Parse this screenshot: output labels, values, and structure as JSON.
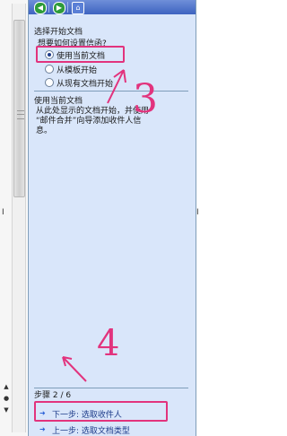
{
  "pane": {
    "section_title": "选择开始文档",
    "question": "想要如何设置信函?",
    "options": [
      {
        "label": "使用当前文档",
        "checked": true
      },
      {
        "label": "从模板开始",
        "checked": false
      },
      {
        "label": "从现有文档开始",
        "checked": false
      }
    ],
    "sub_title": "使用当前文档",
    "description_lines": [
      "从此处显示的文档开始，并使用",
      "“邮件合并”向导添加收件人信",
      "息。"
    ],
    "step_label": "步骤 2 / 6",
    "next_link": "下一步: 选取收件人",
    "prev_link": "上一步: 选取文档类型"
  },
  "annotations": {
    "mark_3": "3",
    "mark_4": "4"
  },
  "colors": {
    "pane_bg": "#d9e6fa",
    "highlight": "#e2337d",
    "link": "#1e3c8a"
  }
}
